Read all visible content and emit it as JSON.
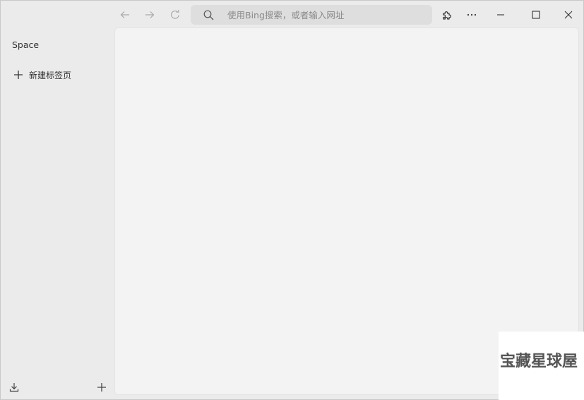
{
  "sidebar": {
    "space_label": "Space",
    "new_tab_label": "新建标签页",
    "icons": {
      "new_tab": "plus-icon",
      "download": "download-icon",
      "add_space": "plus-icon"
    }
  },
  "toolbar": {
    "address_placeholder": "使用Bing搜索，或者输入网址",
    "icons": {
      "back": "arrow-left-icon",
      "forward": "arrow-right-icon",
      "reload": "reload-icon",
      "search": "search-icon",
      "extensions": "puzzle-icon",
      "more": "more-icon",
      "minimize": "minimize-icon",
      "maximize": "maximize-icon",
      "close": "close-icon"
    }
  },
  "watermark": {
    "text": "宝藏星球屋"
  },
  "colors": {
    "sidebar_bg": "#ebebeb",
    "content_bg": "#f3f3f3",
    "address_bg": "#dedede",
    "disabled_icon": "#a8a8a8"
  }
}
